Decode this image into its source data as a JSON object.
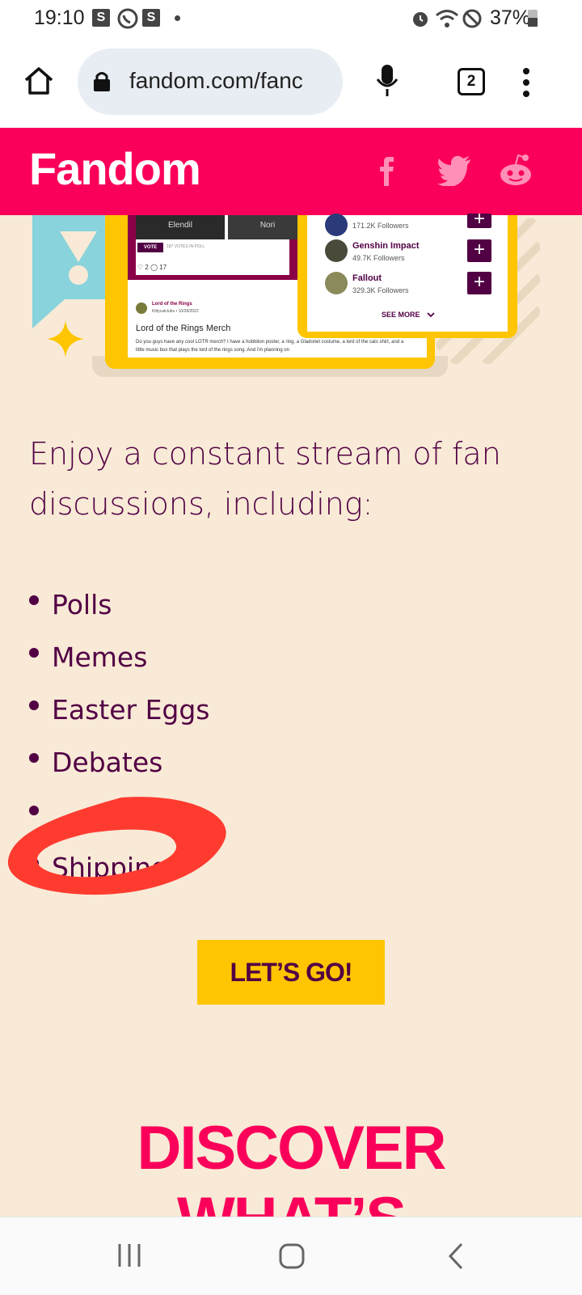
{
  "status_bar": {
    "time": "19:10",
    "app_icons": [
      "S",
      "whatsapp-icon",
      "S"
    ],
    "battery": "37%"
  },
  "browser": {
    "url": "fandom.com/fanc",
    "tab_count": "2"
  },
  "fandom_header": {
    "logo": "Fandom",
    "social": [
      "facebook-icon",
      "twitter-icon",
      "reddit-icon"
    ]
  },
  "illustration": {
    "tiles": [
      "Elendil",
      "Nori"
    ],
    "vote_label": "VOTE",
    "votes_in_poll": "187 VOTES IN POLL",
    "reactions": "♡ 2   ◯ 17",
    "post": {
      "community": "Lord of the Rings",
      "author_date": "Kittycatclubs • 10/28/2022",
      "title": "Lord of the Rings Merch",
      "body": "Do you guys have any cool LOTR merch? I have a hobbiton poster, a ring, a Gladoriel costume, a lord of the cats shirt, and a little music box that plays the lord of the rings song. And i'm planning on"
    },
    "communities": [
      {
        "name": "",
        "followers": "171.2K Followers"
      },
      {
        "name": "Genshin Impact",
        "followers": "49.7K Followers"
      },
      {
        "name": "Fallout",
        "followers": "329.3K Followers"
      }
    ],
    "see_more": "SEE MORE"
  },
  "content": {
    "intro": "Enjoy a constant stream of fan discussions, including:",
    "list": [
      "Polls",
      "Memes",
      "Easter Eggs",
      "Debates",
      "",
      "Shipping"
    ],
    "cta": "LET’S GO!",
    "discover": "DISCOVER",
    "discover_cut": "WHAT’S"
  },
  "colors": {
    "brand": "#fa005a",
    "cream": "#f8ead6",
    "plum": "#520044",
    "yellow": "#ffc500",
    "annotation_red": "#ff3b30"
  }
}
